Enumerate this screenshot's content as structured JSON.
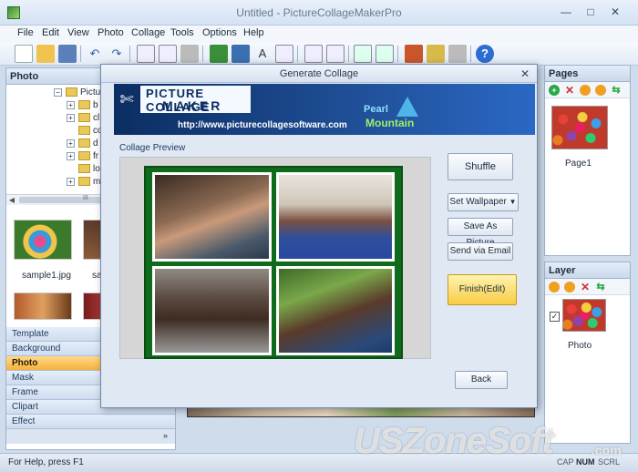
{
  "window": {
    "title": "Untitled - PictureCollageMakerPro"
  },
  "menu": [
    "File",
    "Edit",
    "View",
    "Photo",
    "Collage",
    "Tools",
    "Options",
    "Help"
  ],
  "photo_panel": {
    "title": "Photo",
    "tree_items": [
      "Pictu",
      "b",
      "cl",
      "cc",
      "d",
      "fr",
      "lo",
      "m"
    ],
    "scroll_grip": "III",
    "thumbnails": [
      {
        "caption": "sample1.jpg"
      },
      {
        "caption": "sa"
      }
    ]
  },
  "categories": [
    "Template",
    "Background",
    "Photo",
    "Mask",
    "Frame",
    "Clipart",
    "Effect"
  ],
  "active_category": "Photo",
  "pages_panel": {
    "title": "Pages",
    "page_caption": "Page1"
  },
  "layer_panel": {
    "title": "Layer",
    "layer_caption": "Photo"
  },
  "dialog": {
    "title": "Generate Collage",
    "banner": {
      "logo_line1": "PICTURE COLLAGE",
      "logo_line2": "MAKER",
      "url": "http://www.picturecollagesoftware.com",
      "brand_line1": "Pearl",
      "brand_line2": "Mountain"
    },
    "preview_label": "Collage Preview",
    "buttons": {
      "shuffle": "Shuffle",
      "set_wallpaper": "Set Wallpaper",
      "save_as_picture": "Save As Picture",
      "send_via_email": "Send via Email",
      "finish_edit": "Finish(Edit)",
      "back": "Back"
    },
    "colors": {
      "collage_frame": "#0f6b1c",
      "finish_button": "#f8cc45"
    }
  },
  "status": {
    "help_text": "For Help, press F1",
    "indicators": [
      "CAP",
      "NUM",
      "SCRL"
    ]
  },
  "watermark": {
    "text": "USZoneSoft",
    "suffix": ".com"
  }
}
